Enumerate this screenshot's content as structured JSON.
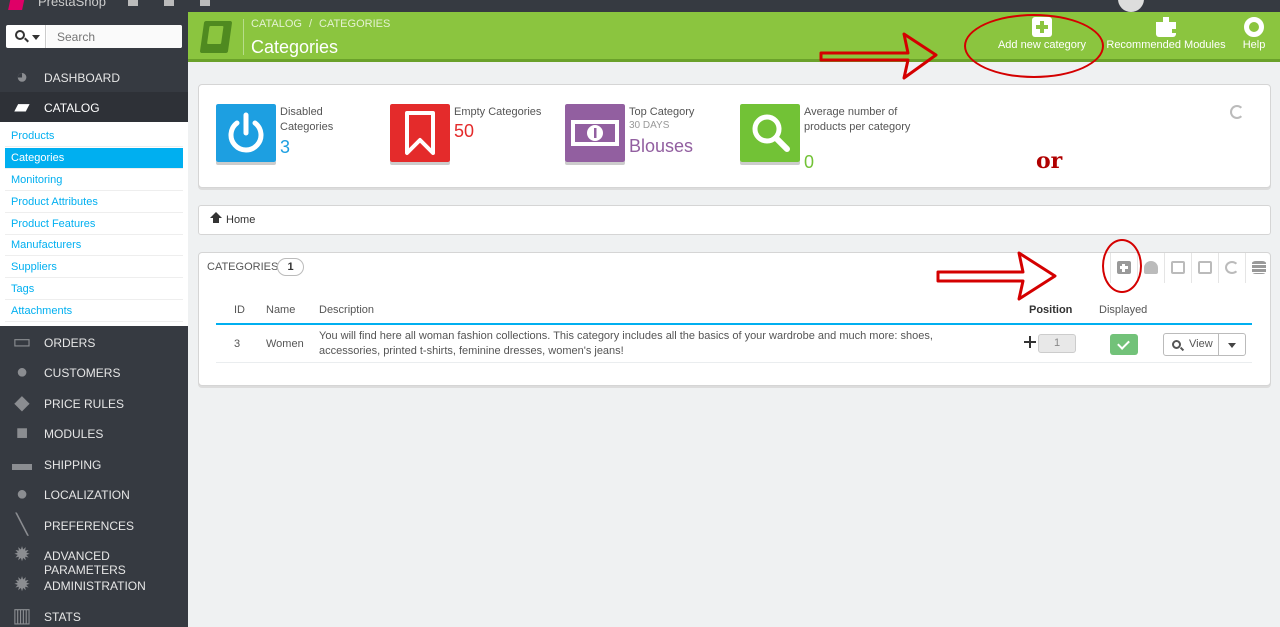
{
  "topbar": {
    "brand": "PrestaShop"
  },
  "search": {
    "placeholder": "Search"
  },
  "sidebar": {
    "items": [
      {
        "label": "DASHBOARD",
        "icon": "dashboard-icon"
      },
      {
        "label": "CATALOG",
        "icon": "book-icon",
        "active": true
      },
      {
        "label": "ORDERS",
        "icon": "credit-card-icon"
      },
      {
        "label": "CUSTOMERS",
        "icon": "users-icon"
      },
      {
        "label": "PRICE RULES",
        "icon": "tags-icon"
      },
      {
        "label": "MODULES",
        "icon": "puzzle-icon"
      },
      {
        "label": "SHIPPING",
        "icon": "truck-icon"
      },
      {
        "label": "LOCALIZATION",
        "icon": "globe-icon"
      },
      {
        "label": "PREFERENCES",
        "icon": "wrench-icon"
      },
      {
        "label": "ADVANCED PARAMETERS",
        "icon": "cogs-icon"
      },
      {
        "label": "ADMINISTRATION",
        "icon": "cog-icon"
      },
      {
        "label": "STATS",
        "icon": "bar-chart-icon"
      }
    ],
    "catalog_submenu": [
      "Products",
      "Categories",
      "Monitoring",
      "Product Attributes",
      "Product Features",
      "Manufacturers",
      "Suppliers",
      "Tags",
      "Attachments"
    ]
  },
  "header": {
    "breadcrumb": [
      "CATALOG",
      "CATEGORIES"
    ],
    "title": "Categories",
    "buttons": {
      "add": "Add new category",
      "recommended": "Recommended Modules",
      "help": "Help"
    }
  },
  "kpis": {
    "disabled": {
      "title": "Disabled Categories",
      "value": "3",
      "color": "#1d9fe1"
    },
    "empty": {
      "title": "Empty Categories",
      "value": "50",
      "color": "#e42b2b"
    },
    "top": {
      "title": "Top Category",
      "subtitle": "30 DAYS",
      "value": "Blouses",
      "color": "#925fa0"
    },
    "average": {
      "title": "Average number of products per category",
      "value": "0",
      "color": "#72c236"
    }
  },
  "home_breadcrumb": "Home",
  "categories_panel": {
    "title": "CATEGORIES",
    "count": "1",
    "columns": {
      "id": "ID",
      "name": "Name",
      "description": "Description",
      "position": "Position",
      "displayed": "Displayed"
    },
    "rows": [
      {
        "id": "3",
        "name": "Women",
        "description": "You will find here all woman fashion collections. This category includes all the basics of your wardrobe and much more: shoes, accessories, printed t-shirts, feminine dresses, women's jeans!",
        "position": "1",
        "view": "View"
      }
    ]
  },
  "annotation": {
    "or": "or"
  },
  "colors": {
    "header_green": "#8bc53f",
    "sidebar_dark": "#363a41",
    "link_blue": "#00aff0",
    "annotation_red": "#d40000"
  }
}
